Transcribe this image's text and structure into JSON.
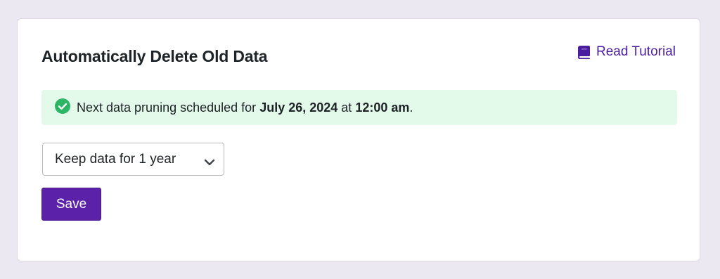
{
  "card": {
    "title": "Automatically Delete Old Data",
    "tutorial_link": {
      "label": "Read Tutorial",
      "icon": "book-icon",
      "color": "#4a1da1"
    }
  },
  "notice": {
    "icon": "check-circle-icon",
    "text_before": "Next data pruning scheduled for",
    "date": "July 26, 2024",
    "text_middle": "at",
    "time": "12:00 am",
    "text_after": ".",
    "background": "#e3f9ea",
    "icon_color": "#2db566"
  },
  "retention_select": {
    "selected": "Keep data for 1 year",
    "icon": "chevron-down-icon"
  },
  "save_button": {
    "label": "Save",
    "background": "#5b21a8"
  }
}
